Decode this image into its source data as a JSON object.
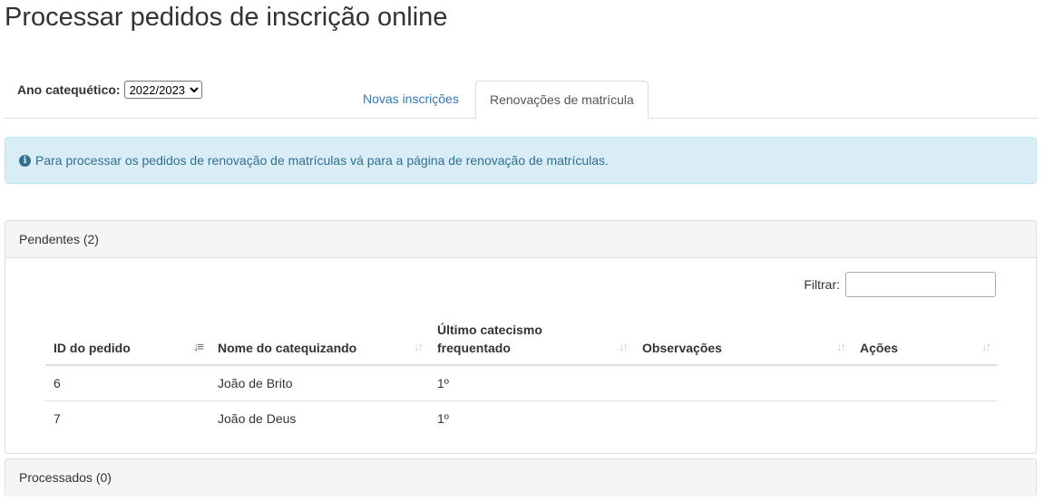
{
  "page": {
    "title": "Processar pedidos de inscrição online"
  },
  "year": {
    "label": "Ano catequético:",
    "selected": "2022/2023"
  },
  "tabs": [
    {
      "label": "Novas inscrições",
      "active": false
    },
    {
      "label": "Renovações de matrícula",
      "active": true
    }
  ],
  "alert": {
    "text": "Para processar os pedidos de renovação de matrículas vá para a página de renovação de matrículas.",
    "icon": "info-circle-icon"
  },
  "pending": {
    "heading": "Pendentes (2)",
    "filter_label": "Filtrar:",
    "filter_value": "",
    "columns": [
      "ID do pedido",
      "Nome do catequizando",
      "Último catecismo frequentado",
      "Observações",
      "Ações"
    ],
    "rows": [
      {
        "id": "6",
        "name": "João de Brito",
        "catecismo": "1º",
        "obs": "",
        "acoes": ""
      },
      {
        "id": "7",
        "name": "João de Deus",
        "catecismo": "1º",
        "obs": "",
        "acoes": ""
      }
    ]
  },
  "processed": {
    "heading": "Processados (0)"
  },
  "colors": {
    "link": "#337ab7",
    "alert_bg": "#d9edf7",
    "alert_text": "#31708f"
  }
}
